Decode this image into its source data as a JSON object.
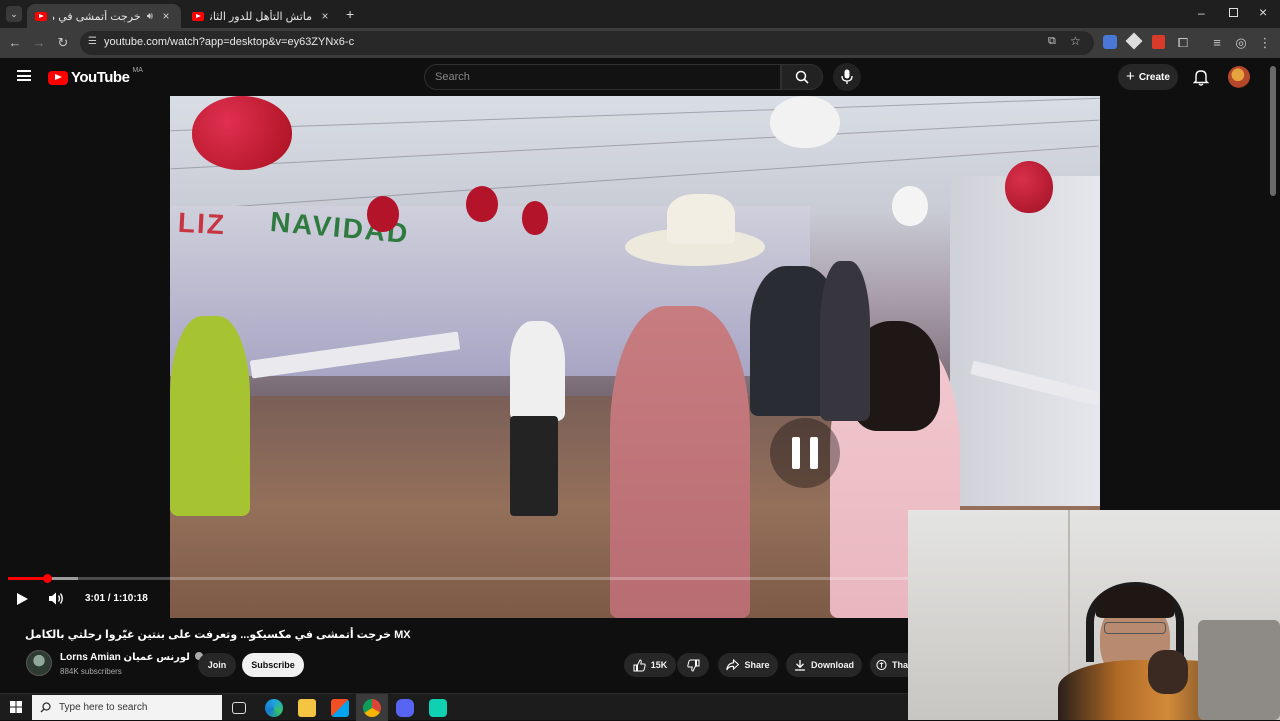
{
  "browser": {
    "tabs": [
      {
        "title": "خرجت أتمشى في مكسيكو...",
        "active": true
      },
      {
        "title": "ماتش التأهل للدور الثاني؟ التشكـ",
        "active": false
      }
    ],
    "url": "youtube.com/watch?app=desktop&v=ey63ZYNx6-c"
  },
  "youtube": {
    "logo_text": "YouTube",
    "country_code": "MA",
    "search_placeholder": "Search",
    "create_label": "Create"
  },
  "player": {
    "state": "paused",
    "current_time": "3:01",
    "duration": "1:10:18",
    "time_display": "3:01 / 1:10:18",
    "progress_fraction": 0.0428
  },
  "video": {
    "title": "خرجت أتمشى في مكسيكو... وتعرفت على بنتين غيّروا رحلتي بالكامل MX",
    "channel_name": "Lorns Amian لورنس عميان",
    "subscribers": "884K subscribers",
    "join_label": "Join",
    "subscribe_label": "Subscribe",
    "likes": "15K",
    "share_label": "Share",
    "download_label": "Download",
    "thanks_label": "Tha"
  },
  "taskbar": {
    "search_placeholder": "Type here to search"
  },
  "colors": {
    "youtube_red": "#ff0000",
    "background": "#0f0f0f"
  }
}
